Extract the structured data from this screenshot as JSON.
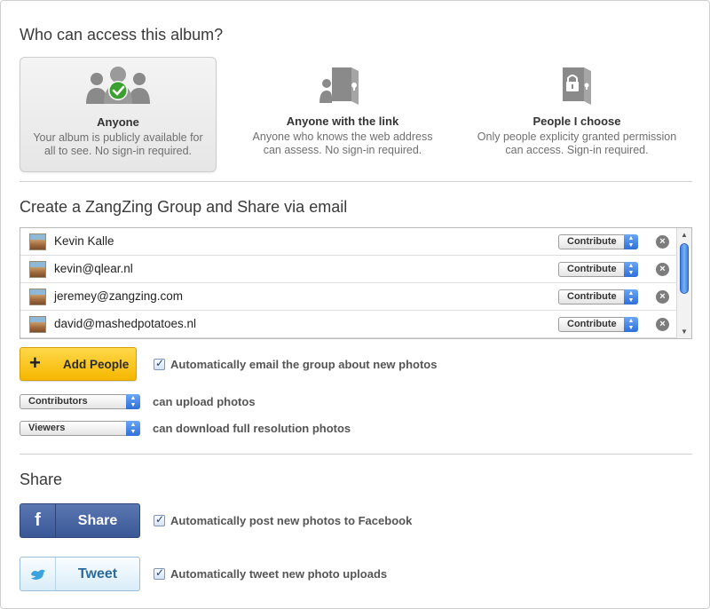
{
  "access": {
    "title": "Who can access this album?",
    "options": [
      {
        "title": "Anyone",
        "desc1": "Your album is publicly available for",
        "desc2": "all to see. No sign-in required.",
        "selected": true,
        "icon": "group-check-icon"
      },
      {
        "title": "Anyone with the link",
        "desc1": "Anyone who knows the web address",
        "desc2": "can assess. No sign-in required.",
        "selected": false,
        "icon": "door-keyhole-icon"
      },
      {
        "title": "People I choose",
        "desc1": "Only people explicity granted permission",
        "desc2": "can access. Sign-in required.",
        "selected": false,
        "icon": "door-lock-icon"
      }
    ]
  },
  "group": {
    "title": "Create a ZangZing Group and Share via email",
    "members": [
      {
        "name": "Kevin Kalle",
        "role": "Contribute"
      },
      {
        "name": "kevin@qlear.nl",
        "role": "Contribute"
      },
      {
        "name": "jeremey@zangzing.com",
        "role": "Contribute"
      },
      {
        "name": "david@mashedpotatoes.nl",
        "role": "Contribute"
      }
    ],
    "add_label": "Add People",
    "add_plus": "+",
    "auto_email": "Automatically email the group about new photos",
    "remove_glyph": "×",
    "permissions": [
      {
        "select": "Contributors",
        "text": "can upload photos"
      },
      {
        "select": "Viewers",
        "text": "can download full resolution photos"
      }
    ]
  },
  "share": {
    "title": "Share",
    "facebook_icon": "f",
    "facebook_label": "Share",
    "facebook_check": "Automatically post new photos to Facebook",
    "twitter_label": "Tweet",
    "twitter_check": "Automatically tweet new photo uploads"
  },
  "colors": {
    "add_button": "#f5b700",
    "facebook": "#3a5896",
    "twitter_text": "#2b6a9b",
    "check_green": "#3aa02e"
  }
}
